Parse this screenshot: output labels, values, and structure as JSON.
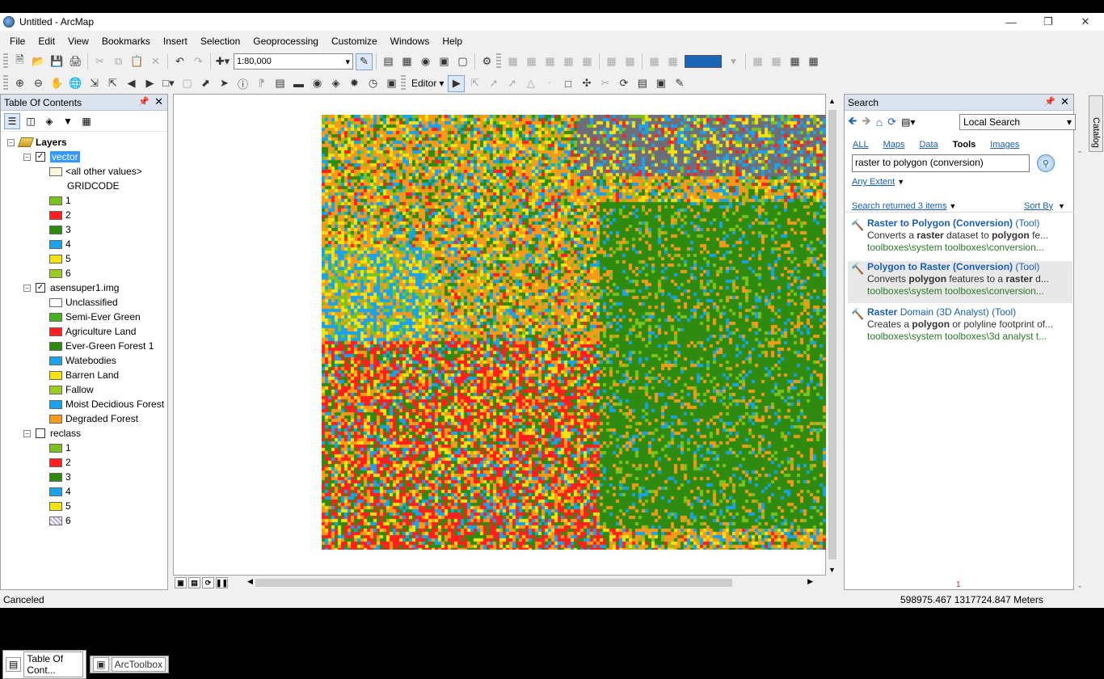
{
  "window": {
    "title": "Untitled - ArcMap"
  },
  "menu": [
    "File",
    "Edit",
    "View",
    "Bookmarks",
    "Insert",
    "Selection",
    "Geoprocessing",
    "Customize",
    "Windows",
    "Help"
  ],
  "toolbar": {
    "scale": "1:80,000",
    "editor_label": "Editor"
  },
  "toc": {
    "title": "Table Of Contents",
    "layers_root": "Layers",
    "vector_layer": {
      "name": "vector",
      "other_values": "<all other values>",
      "field": "GRIDCODE",
      "classes": [
        {
          "label": "1",
          "color": "#7cc21e"
        },
        {
          "label": "2",
          "color": "#ff1f1f"
        },
        {
          "label": "3",
          "color": "#2e8b0f"
        },
        {
          "label": "4",
          "color": "#1aa3e8"
        },
        {
          "label": "5",
          "color": "#f5e214"
        },
        {
          "label": "6",
          "color": "#9ccc22"
        }
      ]
    },
    "image_layer": {
      "name": "asensuper1.img",
      "classes": [
        {
          "label": "Unclassified",
          "color": "#ffffff"
        },
        {
          "label": "Semi-Ever Green",
          "color": "#45b020"
        },
        {
          "label": "Agriculture Land",
          "color": "#ff1f1f"
        },
        {
          "label": "Ever-Green Forest 1",
          "color": "#2e8b0f"
        },
        {
          "label": "Watebodies",
          "color": "#1aa3e8"
        },
        {
          "label": "Barren Land",
          "color": "#f5e214"
        },
        {
          "label": "Fallow",
          "color": "#9ccc22"
        },
        {
          "label": "Moist Decidious Forest",
          "color": "#1aa3e8"
        },
        {
          "label": "Degraded Forest",
          "color": "#f59a1a"
        }
      ]
    },
    "reclass_layer": {
      "name": "reclass",
      "classes": [
        {
          "label": "1",
          "color": "#7cc21e"
        },
        {
          "label": "2",
          "color": "#ff1f1f"
        },
        {
          "label": "3",
          "color": "#2e8b0f"
        },
        {
          "label": "4",
          "color": "#1aa3e8"
        },
        {
          "label": "5",
          "color": "#f5e214"
        },
        {
          "label": "6",
          "color": "#b6a6e6"
        }
      ]
    },
    "tabs": [
      "Table Of Cont...",
      "ArcToolbox"
    ]
  },
  "search": {
    "title": "Search",
    "scope": "Local Search",
    "tabs": [
      "ALL",
      "Maps",
      "Data",
      "Tools",
      "Images"
    ],
    "active_tab": "Tools",
    "query": "raster to polygon (conversion)",
    "extent": "Any Extent",
    "returned": "Search returned 3 items",
    "sort": "Sort By",
    "results": [
      {
        "title": "Raster to Polygon",
        "toolbox": "(Conversion)",
        "kind": "(Tool)",
        "d_pre": "Converts a ",
        "d_b1": "raster",
        "d_mid": " dataset to ",
        "d_b2": "polygon",
        "d_post": " fe...",
        "path": "toolboxes\\system toolboxes\\conversion..."
      },
      {
        "title": "Polygon to Raster",
        "toolbox": "(Conversion)",
        "kind": "(Tool)",
        "d_pre": "Converts ",
        "d_b1": "polygon",
        "d_mid": " features to a ",
        "d_b2": "raster",
        "d_post": " d...",
        "path": "toolboxes\\system toolboxes\\conversion..."
      },
      {
        "title": "Raster",
        "toolbox": "Domain (3D Analyst)",
        "kind": "(Tool)",
        "d_pre": "Creates a ",
        "d_b1": "polygon",
        "d_mid": " or polyline footprint of...",
        "d_b2": "",
        "d_post": "",
        "path": "toolboxes\\system toolboxes\\3d analyst t..."
      }
    ],
    "page": "1"
  },
  "catalog_tab": "Catalog",
  "status": {
    "message": "Canceled",
    "coords": "598975.467  1317724.847 Meters"
  },
  "map_colors": [
    "#2e8b0f",
    "#f59a1a",
    "#1aa3e8",
    "#ff1f1f",
    "#f5e214",
    "#7cc21e",
    "#6e6e7a"
  ]
}
